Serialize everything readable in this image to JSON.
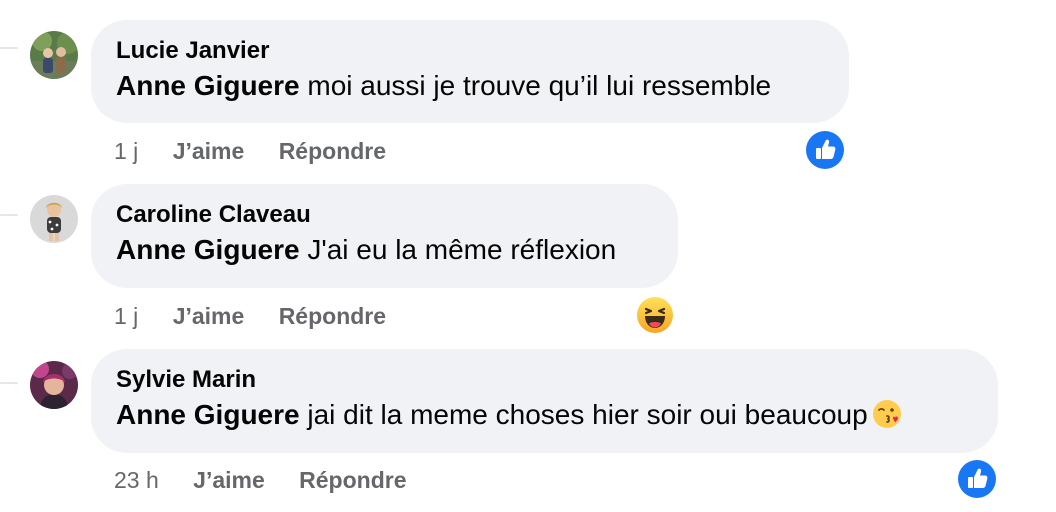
{
  "comments": [
    {
      "author": "Lucie Janvier",
      "mention": "Anne Giguere",
      "text": " moi aussi je trouve qu’il lui ressemble",
      "time": "1 j",
      "like_label": "J’aime",
      "reply_label": "Répondre",
      "reaction": "like-icon"
    },
    {
      "author": "Caroline Claveau",
      "mention": "Anne Giguere",
      "text": " J'ai eu la même réflexion",
      "time": "1 j",
      "like_label": "J’aime",
      "reply_label": "Répondre",
      "reaction": "haha-icon"
    },
    {
      "author": "Sylvie Marin",
      "mention": "Anne Giguere",
      "text": " jai dit la meme choses hier soir oui beaucoup",
      "inline_emoji": "kissing-face-icon",
      "time": "23 h",
      "like_label": "J’aime",
      "reply_label": "Répondre",
      "reaction": "like-icon"
    }
  ],
  "colors": {
    "bubble": "#f0f2f5",
    "meta_text": "#65676b",
    "like_blue": "#1877f2"
  }
}
